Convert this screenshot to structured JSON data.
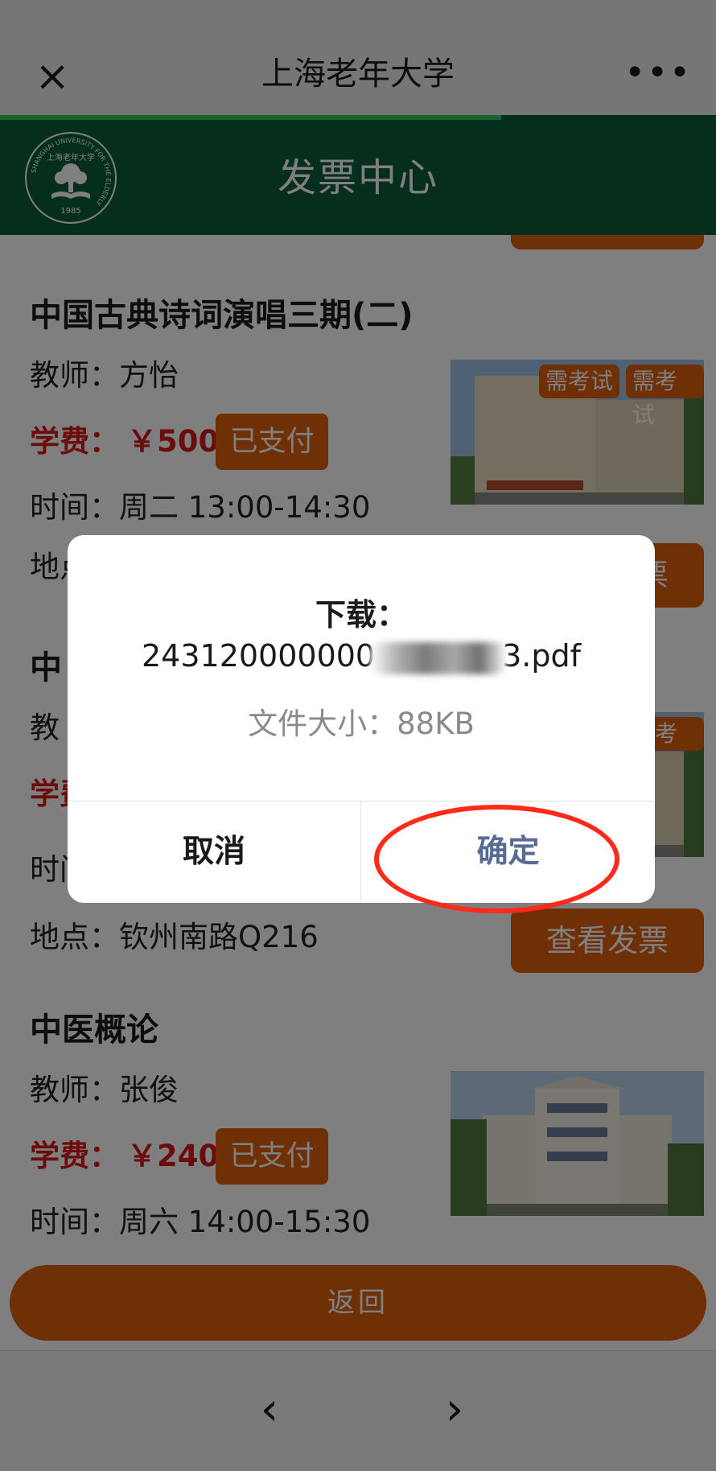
{
  "navbar": {
    "close_glyph": "×",
    "title": "上海老年大学",
    "more_glyph": "•••"
  },
  "banner": {
    "title": "发票中心",
    "logo": {
      "ring_text": "SHANGHAI UNIVERSITY FOR THE ELDERLY",
      "chinese_text": "上海老年大学",
      "year": "1985"
    }
  },
  "courses": [
    {
      "title": "中国古典诗词演唱三期(二)",
      "teacher_label": "教师：",
      "teacher": "方怡",
      "fee_label": "学费：",
      "fee": "￥500",
      "status": "已支付",
      "time_label": "时间：",
      "time": "周二 13:00-14:30",
      "location_label": "地点：",
      "tags": [
        "需考试",
        "需考试"
      ],
      "invoice_button": "查看发票"
    },
    {
      "title": "中",
      "teacher_label": "教",
      "fee_label": "学费",
      "time_label": "时间",
      "location_label": "地点：",
      "location": "钦州南路Q216",
      "tags": [
        "需考试"
      ],
      "invoice_button": "查看发票"
    },
    {
      "title": "中医概论",
      "teacher_label": "教师：",
      "teacher": "张俊",
      "fee_label": "学费：",
      "fee": "￥240",
      "status": "已支付",
      "time_label": "时间：",
      "time": "周六 14:00-15:30"
    }
  ],
  "return_button": "返回",
  "toolbar": {
    "back_glyph": "‹",
    "forward_glyph": "›"
  },
  "dialog": {
    "title": "下载：",
    "filename_prefix": "243120000000",
    "filename_suffix": "3.pdf",
    "size_label": "文件大小：",
    "size_value": "88KB",
    "cancel": "取消",
    "confirm": "确定"
  },
  "colors": {
    "brand_green": "#0c5c3a",
    "accent_orange": "#e0600a",
    "fee_red": "#d61a1a",
    "dialog_confirm": "#576b95",
    "highlight_ring": "#ff2a1a"
  },
  "icons": [
    "close-icon",
    "more-icon",
    "back-arrow-icon",
    "forward-arrow-icon",
    "university-logo"
  ]
}
